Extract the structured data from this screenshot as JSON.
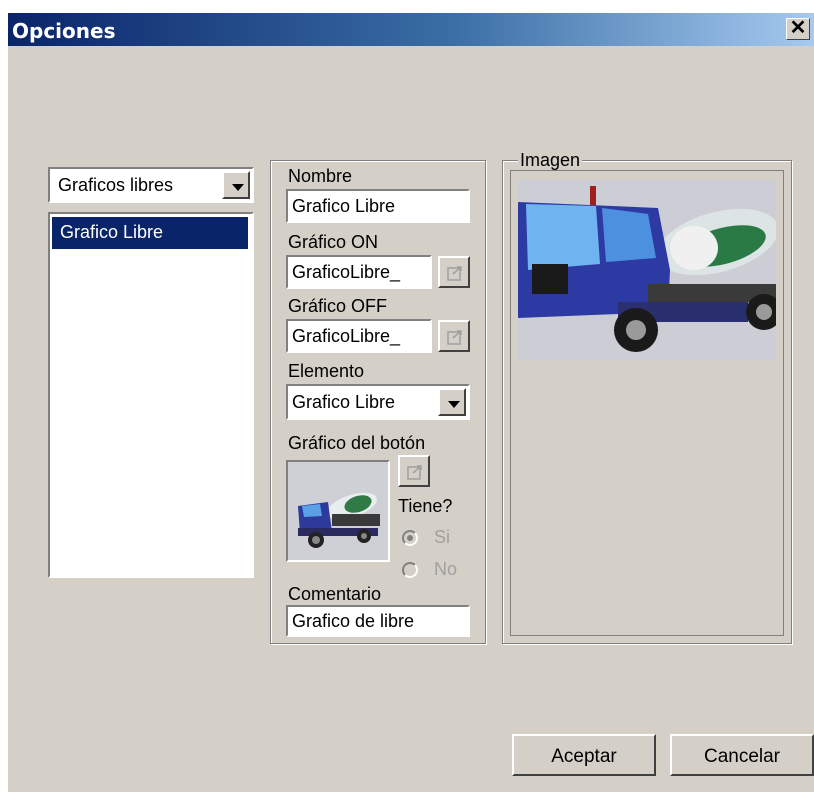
{
  "window": {
    "title": "Opciones",
    "close_glyph": "✕"
  },
  "category_combo": {
    "value": "Graficos libres"
  },
  "list": {
    "items": [
      "Grafico Libre"
    ],
    "selected": 0
  },
  "form": {
    "nombre_label": "Nombre",
    "nombre_value": "Grafico Libre",
    "grafico_on_label": "Gráfico ON",
    "grafico_on_value": "GraficoLibre_",
    "grafico_off_label": "Gráfico OFF",
    "grafico_off_value": "GraficoLibre_",
    "elemento_label": "Elemento",
    "elemento_value": "Grafico Libre",
    "grafico_boton_label": "Gráfico del botón",
    "tiene_label": "Tiene?",
    "radio_si": "Si",
    "radio_no": "No",
    "radio_selected": "Si",
    "comentario_label": "Comentario",
    "comentario_value": "Grafico de libre"
  },
  "image_group": {
    "label": "Imagen"
  },
  "buttons": {
    "accept": "Aceptar",
    "cancel": "Cancelar"
  },
  "colors": {
    "title_start": "#0a246a",
    "title_end": "#a6caf0",
    "selection": "#0a246a",
    "face": "#d4d0c8"
  }
}
